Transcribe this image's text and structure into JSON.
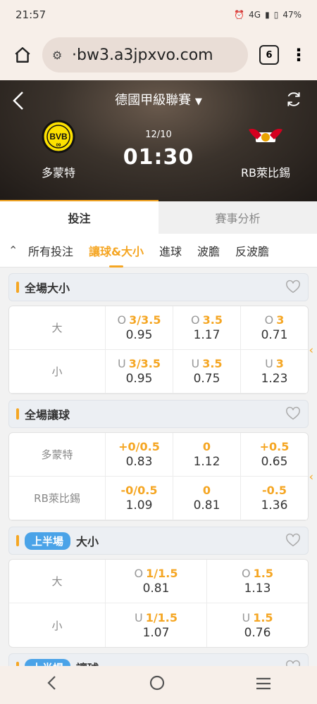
{
  "status": {
    "time": "21:57",
    "network": "4G",
    "battery": "47%"
  },
  "browser": {
    "url": "·bw3.a3jpxvo.com",
    "tab_count": "6"
  },
  "match": {
    "league": "德國甲級聯賽",
    "date": "12/10",
    "kickoff": "01:30",
    "home_team": "多蒙特",
    "away_team": "RB萊比錫"
  },
  "main_tabs": [
    "投注",
    "賽事分析"
  ],
  "sub_tabs": [
    "所有投注",
    "讓球&大小",
    "進球",
    "波膽",
    "反波膽"
  ],
  "sections": [
    {
      "title": "全場大小",
      "rows": [
        {
          "label": "大",
          "cells": [
            {
              "pre": "O",
              "hc": "3/3.5",
              "val": "0.95"
            },
            {
              "pre": "O",
              "hc": "3.5",
              "val": "1.17"
            },
            {
              "pre": "O",
              "hc": "3",
              "val": "0.71"
            }
          ]
        },
        {
          "label": "小",
          "cells": [
            {
              "pre": "U",
              "hc": "3/3.5",
              "val": "0.95"
            },
            {
              "pre": "U",
              "hc": "3.5",
              "val": "0.75"
            },
            {
              "pre": "U",
              "hc": "3",
              "val": "1.23"
            }
          ]
        }
      ]
    },
    {
      "title": "全場讓球",
      "rows": [
        {
          "label": "多蒙特",
          "cells": [
            {
              "pre": "",
              "hc": "+0/0.5",
              "val": "0.83"
            },
            {
              "pre": "",
              "hc": "0",
              "val": "1.12"
            },
            {
              "pre": "",
              "hc": "+0.5",
              "val": "0.65"
            }
          ]
        },
        {
          "label": "RB萊比錫",
          "cells": [
            {
              "pre": "",
              "hc": "-0/0.5",
              "val": "1.09"
            },
            {
              "pre": "",
              "hc": "0",
              "val": "0.81"
            },
            {
              "pre": "",
              "hc": "-0.5",
              "val": "1.36"
            }
          ]
        }
      ]
    },
    {
      "badge": "上半場",
      "title": "大小",
      "rows": [
        {
          "label": "大",
          "cells": [
            {
              "pre": "O",
              "hc": "1/1.5",
              "val": "0.81"
            },
            {
              "pre": "O",
              "hc": "1.5",
              "val": "1.13"
            }
          ]
        },
        {
          "label": "小",
          "cells": [
            {
              "pre": "U",
              "hc": "1/1.5",
              "val": "1.07"
            },
            {
              "pre": "U",
              "hc": "1.5",
              "val": "0.76"
            }
          ]
        }
      ]
    },
    {
      "badge": "上半場",
      "title": "讓球"
    }
  ],
  "colors": {
    "accent": "#f5a623",
    "badge": "#4aa3e8"
  }
}
